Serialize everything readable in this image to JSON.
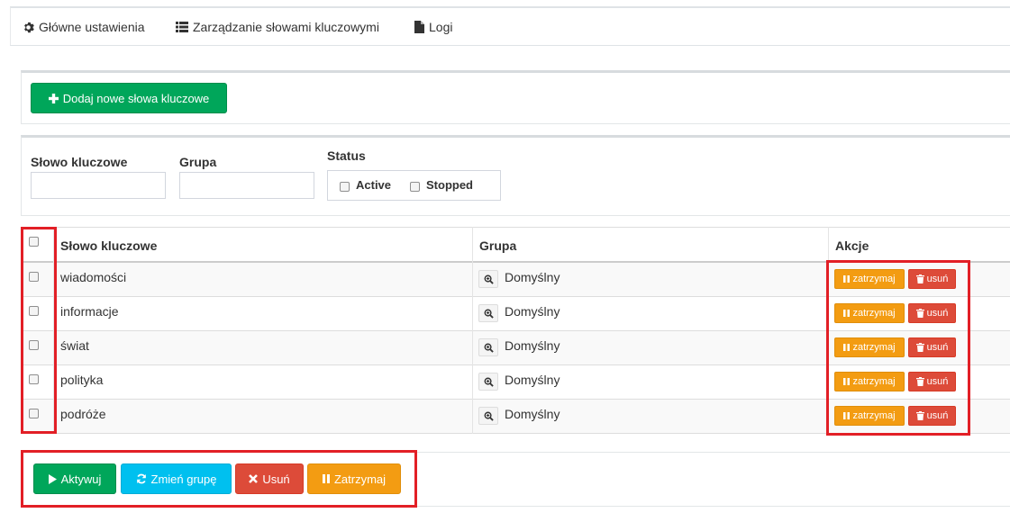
{
  "nav": {
    "items": [
      {
        "label": "Główne ustawienia",
        "icon": "gear-icon"
      },
      {
        "label": "Zarządzanie słowami kluczowymi",
        "icon": "list-icon"
      },
      {
        "label": "Logi",
        "icon": "file-icon"
      }
    ]
  },
  "add_button": {
    "label": "Dodaj nowe słowa kluczowe",
    "icon": "plus-icon"
  },
  "filters": {
    "keyword_label": "Słowo kluczowe",
    "keyword_value": "",
    "group_label": "Grupa",
    "group_value": "",
    "status_label": "Status",
    "status_options": [
      {
        "label": "Active",
        "checked": false
      },
      {
        "label": "Stopped",
        "checked": false
      }
    ]
  },
  "table": {
    "headers": {
      "keyword": "Słowo kluczowe",
      "group": "Grupa",
      "actions": "Akcje"
    },
    "rows": [
      {
        "keyword": "wiadomości",
        "group": "Domyślny"
      },
      {
        "keyword": "informacje",
        "group": "Domyślny"
      },
      {
        "keyword": "świat",
        "group": "Domyślny"
      },
      {
        "keyword": "polityka",
        "group": "Domyślny"
      },
      {
        "keyword": "podróże",
        "group": "Domyślny"
      }
    ],
    "row_actions": {
      "pause": "zatrzymaj",
      "delete": "usuń"
    }
  },
  "bulk_actions": {
    "activate": "Aktywuj",
    "change_group": "Zmień grupę",
    "delete": "Usuń",
    "pause": "Zatrzymaj"
  },
  "colors": {
    "green": "#00a65a",
    "blue": "#00c0ef",
    "red": "#dd4b39",
    "orange": "#f39c12",
    "highlight": "#e21f26"
  }
}
